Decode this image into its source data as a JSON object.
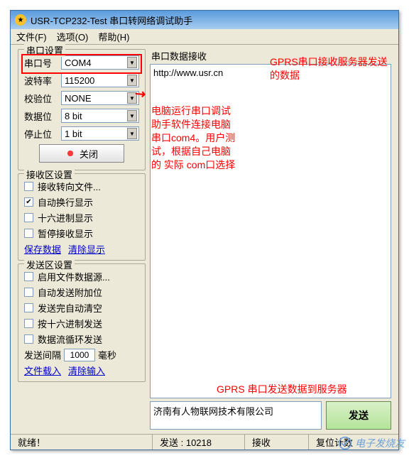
{
  "title": "USR-TCP232-Test 串口转网络调试助手",
  "menu": {
    "file": "文件(F)",
    "options": "选项(O)",
    "help": "帮助(H)"
  },
  "serial": {
    "group": "串口设置",
    "port_label": "串口号",
    "port_value": "COM4",
    "baud_label": "波特率",
    "baud_value": "115200",
    "parity_label": "校验位",
    "parity_value": "NONE",
    "databits_label": "数据位",
    "databits_value": "8 bit",
    "stopbits_label": "停止位",
    "stopbits_value": "1 bit",
    "close_btn": "关闭"
  },
  "rx_settings": {
    "group": "接收区设置",
    "to_file": "接收转向文件...",
    "auto_wrap": "自动换行显示",
    "hex": "十六进制显示",
    "pause": "暂停接收显示",
    "save": "保存数据",
    "clear": "清除显示"
  },
  "tx_settings": {
    "group": "发送区设置",
    "file_src": "启用文件数据源...",
    "auto_extra": "自动发送附加位",
    "auto_clear": "发送完自动清空",
    "hex_send": "按十六进制发送",
    "loop_send": "数据流循环发送",
    "interval_label": "发送间隔",
    "interval_value": "1000",
    "interval_unit": "毫秒",
    "file_load": "文件载入",
    "clear_input": "清除输入"
  },
  "rx_area": {
    "label": "串口数据接收",
    "content": "http://www.usr.cn"
  },
  "send_area": {
    "input_value": "济南有人物联网技术有限公司",
    "send_btn": "发送"
  },
  "status": {
    "ready": "就绪！",
    "send": "发送 : 10218",
    "recv": "接收",
    "reset": "复位计数"
  },
  "annot": {
    "rx_note": "GPRS串口接收服务器发送的数据",
    "serial_note": "电脑运行串口调试助手软件连接电脑串口com4。用户测试，根据自己电脑的 实际 com口选择",
    "tx_note": "GPRS 串口发送数据到服务器"
  },
  "watermark": "电子发烧友"
}
